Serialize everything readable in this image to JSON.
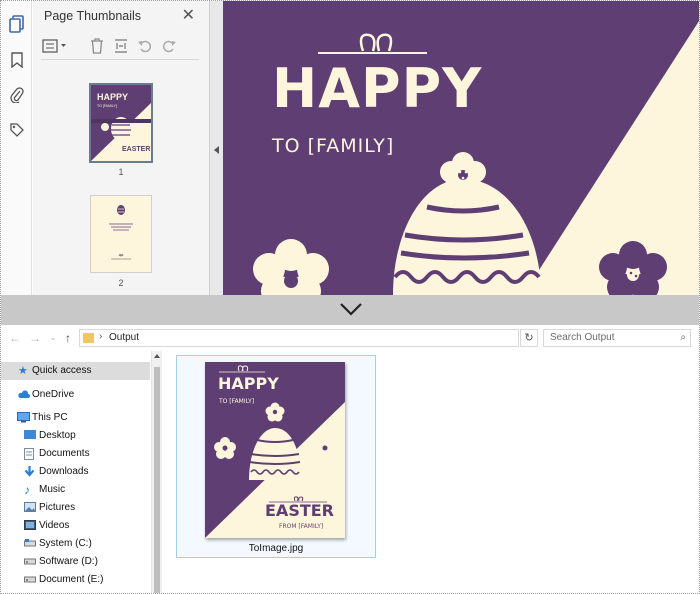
{
  "pdf_viewer": {
    "panel_title": "Page Thumbnails",
    "thumbnails": [
      {
        "number": "1"
      },
      {
        "number": "2"
      }
    ]
  },
  "page": {
    "headline": "HAPPY",
    "subline": "TO [FAMILY]"
  },
  "explorer": {
    "breadcrumb": "Output",
    "search_placeholder": "Search Output",
    "nav_items": [
      {
        "label": "Quick access",
        "icon": "star-icon",
        "selected": true
      },
      {
        "label": "OneDrive",
        "icon": "cloud-icon"
      },
      {
        "label": "This PC",
        "icon": "monitor-icon"
      },
      {
        "label": "Desktop",
        "icon": "desktop-folder-icon"
      },
      {
        "label": "Documents",
        "icon": "documents-folder-icon"
      },
      {
        "label": "Downloads",
        "icon": "download-icon"
      },
      {
        "label": "Music",
        "icon": "music-icon"
      },
      {
        "label": "Pictures",
        "icon": "pictures-folder-icon"
      },
      {
        "label": "Videos",
        "icon": "videos-folder-icon"
      },
      {
        "label": "System (C:)",
        "icon": "drive-icon"
      },
      {
        "label": "Software (D:)",
        "icon": "drive-icon"
      },
      {
        "label": "Document (E:)",
        "icon": "drive-icon"
      }
    ],
    "file": {
      "name": "ToImage.jpg",
      "headline": "HAPPY",
      "subline": "TO [FAMILY]",
      "bottom_title": "EASTER",
      "bottom_sub": "FROM [FAMILY]"
    }
  },
  "colors": {
    "purple": "#5e3e73",
    "cream": "#fdf6dc",
    "accent_blue": "#4a6f9a"
  }
}
